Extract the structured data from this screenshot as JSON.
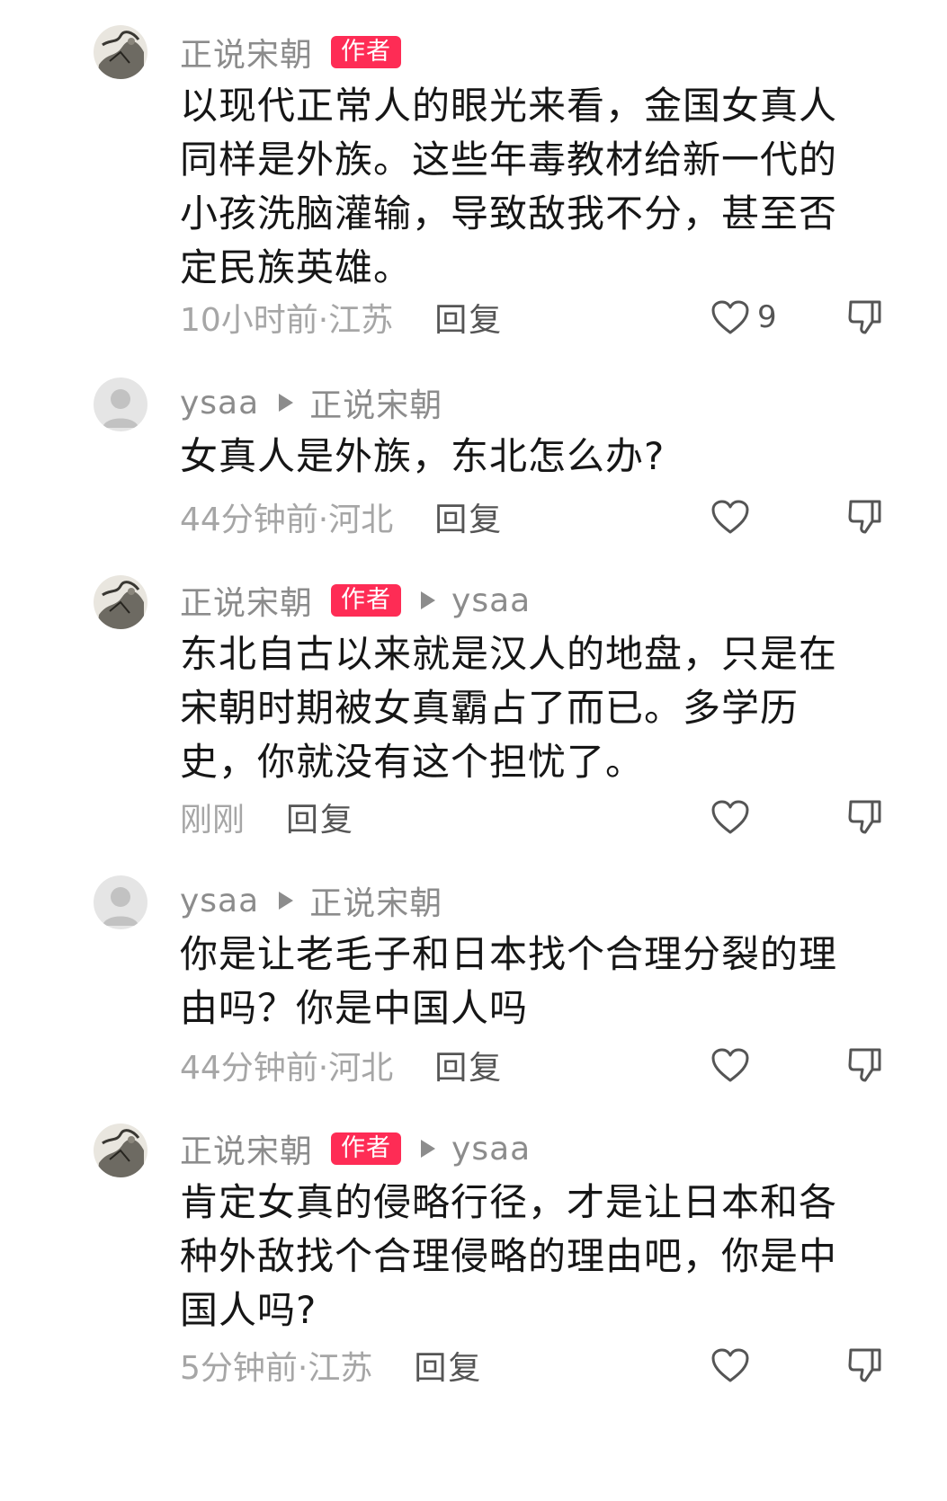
{
  "comments": [
    {
      "username": "正说宋朝",
      "is_author": true,
      "author_badge": "作者",
      "reply_to": "",
      "avatar": "ink-painting-avatar",
      "text": "以现代正常人的眼光来看，金国女真人同样是外族。这些年毒教材给新一代的小孩洗脑灌输，导致敌我不分，甚至否定民族英雄。",
      "time_location": "10小时前·江苏",
      "reply_label": "回复",
      "likes": "9"
    },
    {
      "username": "ysaa",
      "is_author": false,
      "author_badge": "",
      "reply_to": "正说宋朝",
      "avatar": "default-avatar",
      "text": "女真人是外族，东北怎么办?",
      "time_location": "44分钟前·河北",
      "reply_label": "回复",
      "likes": ""
    },
    {
      "username": "正说宋朝",
      "is_author": true,
      "author_badge": "作者",
      "reply_to": "ysaa",
      "avatar": "ink-painting-avatar",
      "text": "东北自古以来就是汉人的地盘，只是在宋朝时期被女真霸占了而已。多学历史，你就没有这个担忧了。",
      "time_location": "刚刚",
      "reply_label": "回复",
      "likes": ""
    },
    {
      "username": "ysaa",
      "is_author": false,
      "author_badge": "",
      "reply_to": "正说宋朝",
      "avatar": "default-avatar",
      "text": "你是让老毛子和日本找个合理分裂的理由吗？你是中国人吗",
      "time_location": "44分钟前·河北",
      "reply_label": "回复",
      "likes": ""
    },
    {
      "username": "正说宋朝",
      "is_author": true,
      "author_badge": "作者",
      "reply_to": "ysaa",
      "avatar": "ink-painting-avatar",
      "text": "肯定女真的侵略行径，才是让日本和各种外敌找个合理侵略的理由吧，你是中国人吗?",
      "time_location": "5分钟前·江苏",
      "reply_label": "回复",
      "likes": ""
    }
  ],
  "icons": {
    "like": "heart-outline-icon",
    "dislike": "thumbs-down-outline-icon",
    "reply_arrow": "triangle-right-icon"
  },
  "colors": {
    "author_badge": "#fe2c55",
    "secondary_text": "#8c8c8c",
    "primary_text": "#161616"
  }
}
